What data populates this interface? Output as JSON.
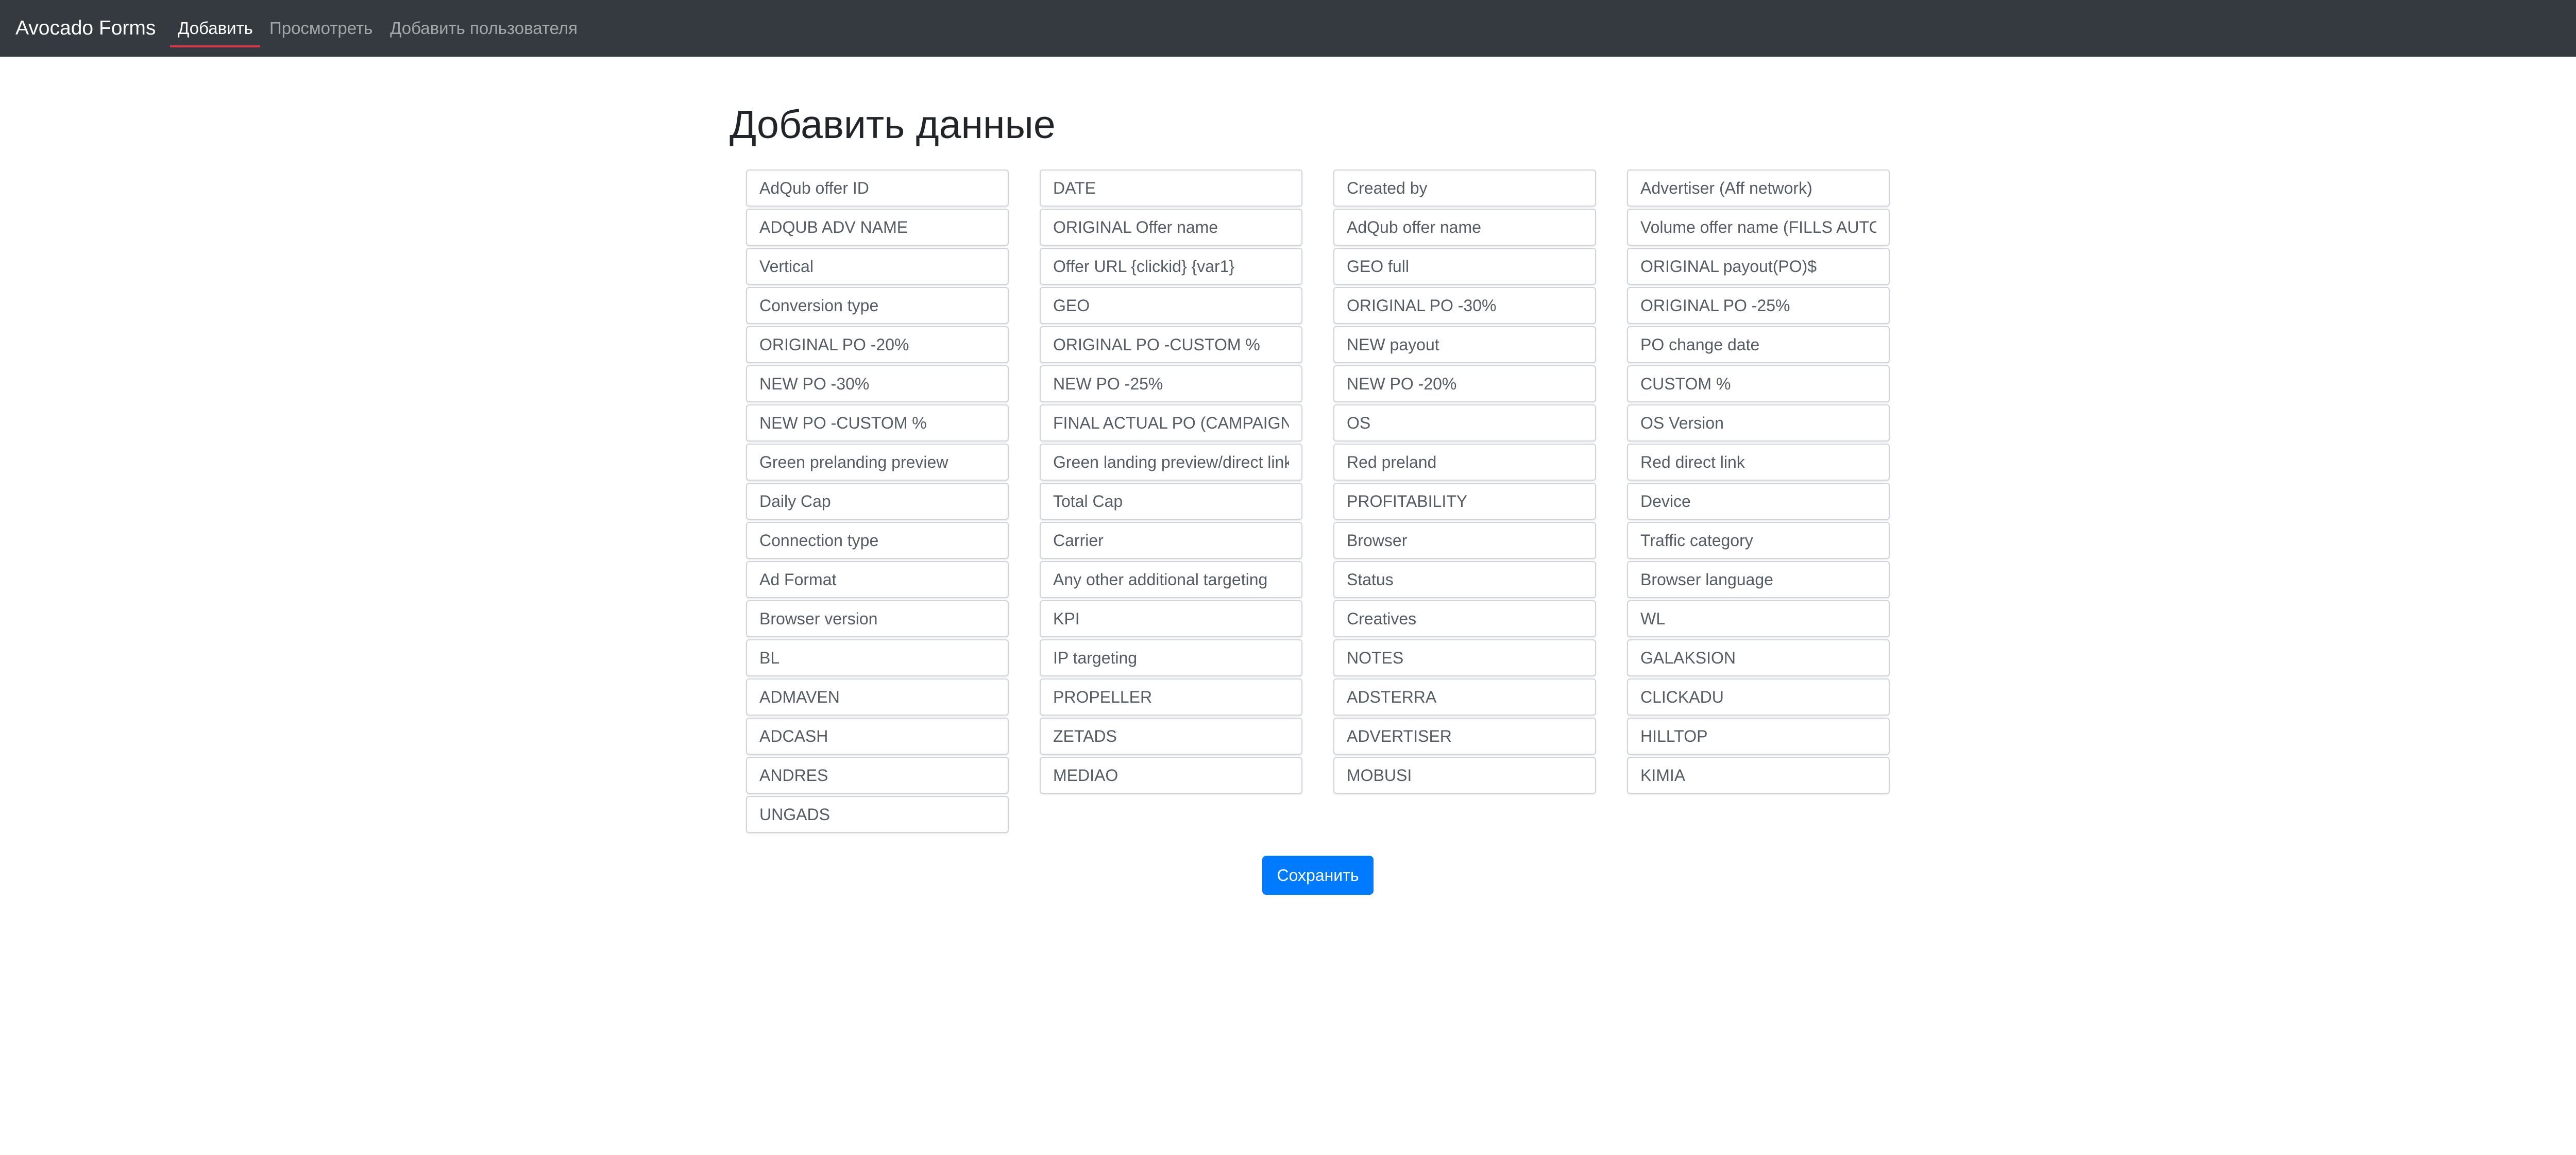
{
  "navbar": {
    "brand": "Avocado Forms",
    "links": [
      {
        "label": "Добавить",
        "active": true
      },
      {
        "label": "Просмотреть",
        "active": false
      },
      {
        "label": "Добавить пользователя",
        "active": false
      }
    ]
  },
  "page": {
    "title": "Добавить данные"
  },
  "form": {
    "columns": [
      {
        "fields": [
          {
            "placeholder": "AdQub offer ID",
            "value": ""
          },
          {
            "placeholder": "ADQUB ADV NAME",
            "value": ""
          },
          {
            "placeholder": "Vertical",
            "value": ""
          },
          {
            "placeholder": "Conversion type",
            "value": ""
          },
          {
            "placeholder": "ORIGINAL PO -20%",
            "value": ""
          },
          {
            "placeholder": "NEW PO -30%",
            "value": ""
          },
          {
            "placeholder": "NEW PO -CUSTOM %",
            "value": ""
          },
          {
            "placeholder": "Green prelanding preview",
            "value": ""
          },
          {
            "placeholder": "Daily Cap",
            "value": ""
          },
          {
            "placeholder": "Connection type",
            "value": ""
          },
          {
            "placeholder": "Ad Format",
            "value": ""
          },
          {
            "placeholder": "Browser version",
            "value": ""
          },
          {
            "placeholder": "BL",
            "value": ""
          },
          {
            "placeholder": "ADMAVEN",
            "value": ""
          },
          {
            "placeholder": "ADCASH",
            "value": ""
          },
          {
            "placeholder": "ANDRES",
            "value": ""
          },
          {
            "placeholder": "UNGADS",
            "value": ""
          }
        ]
      },
      {
        "fields": [
          {
            "placeholder": "DATE",
            "value": ""
          },
          {
            "placeholder": "ORIGINAL Offer name",
            "value": ""
          },
          {
            "placeholder": "Offer URL {clickid} {var1}",
            "value": ""
          },
          {
            "placeholder": "GEO",
            "value": ""
          },
          {
            "placeholder": "ORIGINAL PO -CUSTOM %",
            "value": ""
          },
          {
            "placeholder": "NEW PO -25%",
            "value": ""
          },
          {
            "placeholder": "FINAL ACTUAL PO (CAMPAIGNS)",
            "value": ""
          },
          {
            "placeholder": "Green landing preview/direct link",
            "value": ""
          },
          {
            "placeholder": "Total Cap",
            "value": ""
          },
          {
            "placeholder": "Carrier",
            "value": ""
          },
          {
            "placeholder": "Any other additional targeting",
            "value": ""
          },
          {
            "placeholder": "KPI",
            "value": ""
          },
          {
            "placeholder": "IP targeting",
            "value": ""
          },
          {
            "placeholder": "PROPELLER",
            "value": ""
          },
          {
            "placeholder": "ZETADS",
            "value": ""
          },
          {
            "placeholder": "MEDIAO",
            "value": ""
          }
        ]
      },
      {
        "fields": [
          {
            "placeholder": "Created by",
            "value": ""
          },
          {
            "placeholder": "AdQub offer name",
            "value": ""
          },
          {
            "placeholder": "GEO full",
            "value": ""
          },
          {
            "placeholder": "ORIGINAL PO -30%",
            "value": ""
          },
          {
            "placeholder": "NEW payout",
            "value": ""
          },
          {
            "placeholder": "NEW PO -20%",
            "value": ""
          },
          {
            "placeholder": "OS",
            "value": ""
          },
          {
            "placeholder": "Red preland",
            "value": ""
          },
          {
            "placeholder": "PROFITABILITY",
            "value": ""
          },
          {
            "placeholder": "Browser",
            "value": ""
          },
          {
            "placeholder": "Status",
            "value": ""
          },
          {
            "placeholder": "Creatives",
            "value": ""
          },
          {
            "placeholder": "NOTES",
            "value": ""
          },
          {
            "placeholder": "ADSTERRA",
            "value": ""
          },
          {
            "placeholder": "ADVERTISER",
            "value": ""
          },
          {
            "placeholder": "MOBUSI",
            "value": ""
          }
        ]
      },
      {
        "fields": [
          {
            "placeholder": "Advertiser (Aff network)",
            "value": ""
          },
          {
            "placeholder": "Volume offer name (FILLS AUTOMATICALLY)",
            "value": ""
          },
          {
            "placeholder": "ORIGINAL payout(PO)$",
            "value": ""
          },
          {
            "placeholder": "ORIGINAL PO -25%",
            "value": ""
          },
          {
            "placeholder": "PO change date",
            "value": ""
          },
          {
            "placeholder": "CUSTOM %",
            "value": ""
          },
          {
            "placeholder": "OS Version",
            "value": ""
          },
          {
            "placeholder": "Red direct link",
            "value": ""
          },
          {
            "placeholder": "Device",
            "value": ""
          },
          {
            "placeholder": "Traffic category",
            "value": ""
          },
          {
            "placeholder": "Browser language",
            "value": ""
          },
          {
            "placeholder": "WL",
            "value": ""
          },
          {
            "placeholder": "GALAKSION",
            "value": ""
          },
          {
            "placeholder": "CLICKADU",
            "value": ""
          },
          {
            "placeholder": "HILLTOP",
            "value": ""
          },
          {
            "placeholder": "KIMIA",
            "value": ""
          }
        ]
      }
    ],
    "submit_label": "Сохранить"
  },
  "colors": {
    "navbar_bg": "#343a40",
    "nav_active_underline": "#dc3545",
    "primary_button": "#007bff"
  }
}
